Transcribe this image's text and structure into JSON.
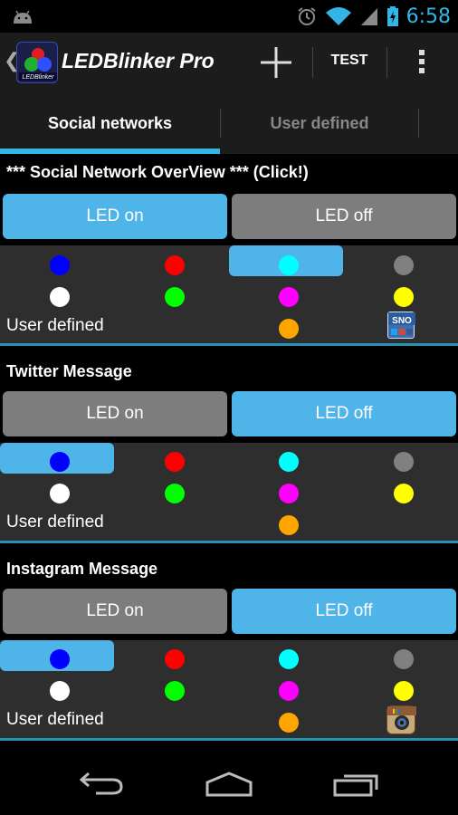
{
  "status_bar": {
    "time": "6:58",
    "icons": [
      "android-icon",
      "alarm-icon",
      "wifi-icon",
      "signal-icon",
      "battery-charging-icon"
    ],
    "accent_color": "#33b5e5"
  },
  "action_bar": {
    "title": "LEDBlinker Pro",
    "logo_text": "LEDBlinker",
    "test_label": "TEST",
    "icons": [
      "back-chevron-icon",
      "app-logo-icon",
      "plus-icon",
      "overflow-menu-icon"
    ]
  },
  "tabs": [
    {
      "label": "Social networks",
      "active": true
    },
    {
      "label": "User defined",
      "active": false
    }
  ],
  "sections": [
    {
      "title": "*** Social Network OverView *** (Click!)",
      "led_on_label": "LED on",
      "led_off_label": "LED off",
      "active_button": "on",
      "selected_color": "cyan",
      "user_defined_label": "User defined",
      "app_icon": "sno-icon",
      "app_icon_text": "SNO"
    },
    {
      "title": "Twitter Message",
      "led_on_label": "LED on",
      "led_off_label": "LED off",
      "active_button": "off",
      "selected_color": "blue",
      "user_defined_label": "User defined",
      "app_icon": ""
    },
    {
      "title": "Instagram Message",
      "led_on_label": "LED on",
      "led_off_label": "LED off",
      "active_button": "off",
      "selected_color": "blue",
      "user_defined_label": "User defined",
      "app_icon": "instagram-icon"
    }
  ],
  "colors": {
    "blue": "#0000ff",
    "red": "#ff0000",
    "cyan": "#00ffff",
    "gray": "#808080",
    "white": "#ffffff",
    "green": "#00ff00",
    "magenta": "#ff00ff",
    "yellow": "#ffff00",
    "orange": "#ffa500"
  },
  "nav_bar": {
    "icons": [
      "back-icon",
      "home-icon",
      "recent-apps-icon"
    ]
  }
}
